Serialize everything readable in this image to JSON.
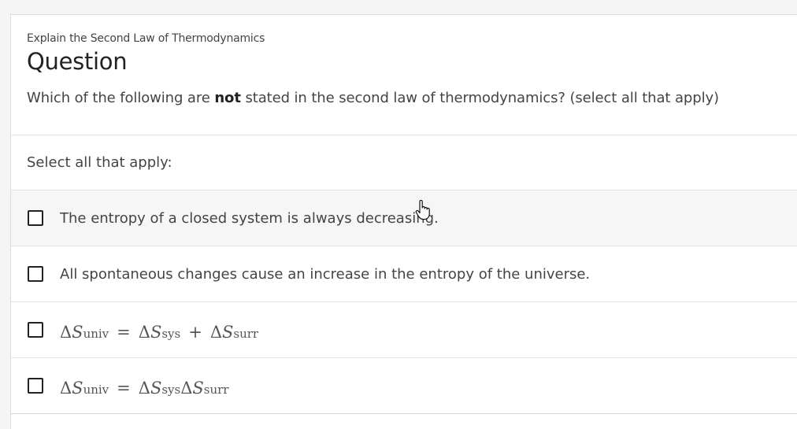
{
  "question": {
    "subtitle": "Explain the Second Law of Thermodynamics",
    "title": "Question",
    "text_before": "Which of the following are ",
    "text_bold": "not",
    "text_after": " stated in the second law of thermodynamics? (select all that apply)"
  },
  "select_label": "Select all that apply:",
  "options": [
    {
      "text": "The entropy of a closed system is always decreasing.",
      "checked": false
    },
    {
      "text": "All spontaneous changes cause an increase in the entropy of the universe.",
      "checked": false
    },
    {
      "math": {
        "d1": "Δ",
        "S1": "S",
        "sub1": "univ",
        "eq": "=",
        "d2": "Δ",
        "S2": "S",
        "sub2": "sys",
        "plus": "+",
        "d3": "Δ",
        "S3": "S",
        "sub3": "surr"
      },
      "checked": false
    },
    {
      "math": {
        "d1": "Δ",
        "S1": "S",
        "sub1": "univ",
        "eq": "=",
        "d2": "Δ",
        "S2": "S",
        "sub2": "sys",
        "d3": "Δ",
        "S3": "S",
        "sub3": "surr"
      },
      "checked": false
    }
  ],
  "colors": {
    "page_bg": "#f5f5f5",
    "card_bg": "#ffffff",
    "hover_bg": "#f6f6f6",
    "border": "#e2e2e2"
  },
  "icons": {
    "cursor": "hand-pointer-icon",
    "checkbox": "checkbox-unchecked-icon"
  }
}
